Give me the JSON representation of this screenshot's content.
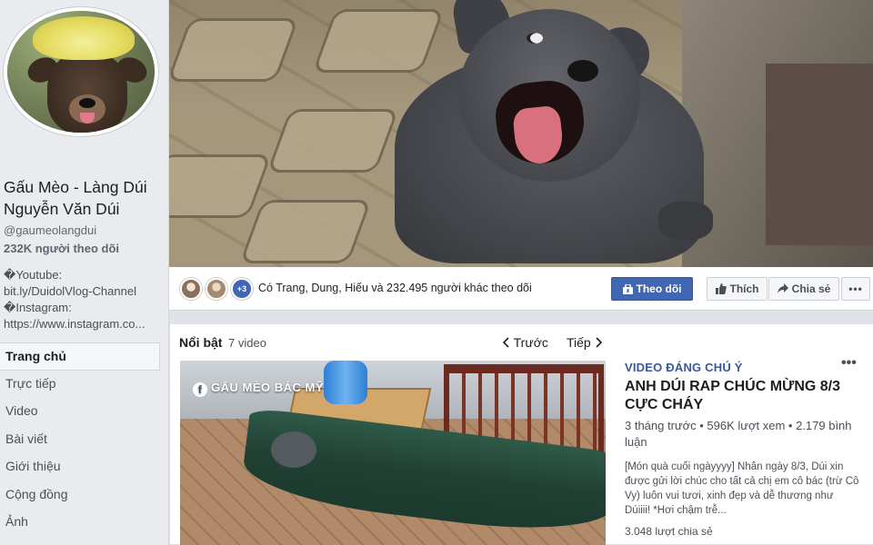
{
  "sidebar": {
    "page_name": "Gấu Mèo - Làng Dúi Nguyễn Văn Dúi",
    "handle": "@gaumeolangdui",
    "followers": "232K người theo dõi",
    "about": [
      "�Youtube:",
      "bit.ly/DuidolVlog-Channel",
      "�Instagram:",
      "https://www.instagram.co..."
    ],
    "nav": [
      {
        "label": "Trang chủ",
        "active": true
      },
      {
        "label": "Trực tiếp"
      },
      {
        "label": "Video"
      },
      {
        "label": "Bài viết"
      },
      {
        "label": "Giới thiệu"
      },
      {
        "label": "Cộng đồng"
      },
      {
        "label": "Ảnh"
      }
    ]
  },
  "action_bar": {
    "friends_more": "+3",
    "followers_text": "Có Trang, Dung, Hiếu và 232.495 người khác theo dõi",
    "follow_label": "Theo dõi",
    "like_label": "Thích",
    "share_label": "Chia sẻ",
    "more_label": "•••"
  },
  "featured": {
    "title": "Nổi bật",
    "count": "7 video",
    "prev_label": "Trước",
    "next_label": "Tiếp",
    "video": {
      "watermark": "GẤU MÈO BÁC MỸ",
      "label": "VIDEO ĐÁNG CHÚ Ý",
      "title": "ANH DÚI RAP CHÚC MỪNG 8/3 CỰC CHÁY",
      "meta": "3 tháng trước • 596K lượt xem • 2.179 bình luận",
      "description": "[Món quà cuối ngàyyyy] Nhân ngày 8/3, Dúi xin được gửi lời chúc cho tất cả chị em cô bác (trừ Cô Vy) luôn vui tươi, xinh đẹp và dễ thương như Dúiiii! *Hơi chậm trễ...",
      "shares": "3.048 lượt chia sẻ",
      "menu_label": "•••"
    }
  },
  "colors": {
    "accent": "#4267b2",
    "link": "#385898"
  }
}
